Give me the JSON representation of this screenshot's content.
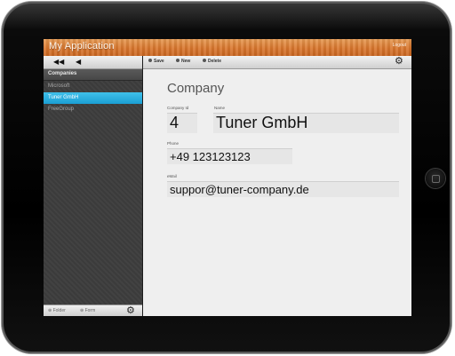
{
  "app": {
    "title": "My Application",
    "logout_label": "Logout"
  },
  "sidebar": {
    "toolbar": {
      "back_all_icon": "◀◀",
      "back_icon": "◀"
    },
    "header": "Companies",
    "items": [
      {
        "label": "Microsoft",
        "selected": false
      },
      {
        "label": "Tuner GmbH",
        "selected": true
      },
      {
        "label": "FreeGroup",
        "selected": false
      }
    ],
    "bottom": {
      "folder_label": "Folder",
      "form_label": "Form",
      "gear_icon": "⚙"
    }
  },
  "toolbar": {
    "save_label": "Save",
    "new_label": "New",
    "delete_label": "Delete",
    "gear_icon": "⚙"
  },
  "form": {
    "heading": "Company",
    "company_id_label": "Company Id",
    "company_id_value": "4",
    "name_label": "Name",
    "name_value": "Tuner GmbH",
    "phone_label": "Phone",
    "phone_value": "+49 123123123",
    "email_label": "eMail",
    "email_value": "suppor@tuner-company.de"
  },
  "colors": {
    "titlebar": "#d9762d",
    "selection": "#1b9fd4",
    "sidebar_bg": "#3d3d3d"
  }
}
